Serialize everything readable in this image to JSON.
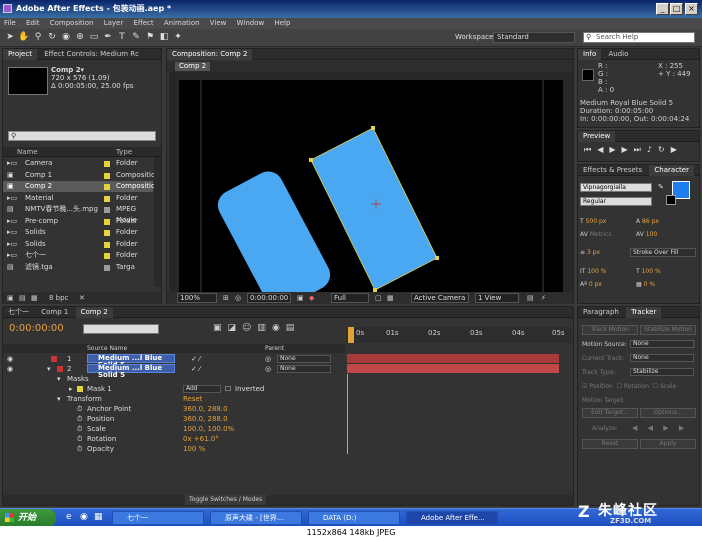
{
  "window": {
    "title": "Adobe After Effects - 包装动画.aep *"
  },
  "menu": [
    "File",
    "Edit",
    "Composition",
    "Layer",
    "Effect",
    "Animation",
    "View",
    "Window",
    "Help"
  ],
  "toolbar": {
    "workspace_label": "Workspace:",
    "workspace_value": "Standard",
    "search_placeholder": "Search Help"
  },
  "project": {
    "tabs": [
      "Project",
      "Effect Controls: Medium Rc"
    ],
    "comp_name": "Comp 2▾",
    "comp_size": "720 x 576 (1.09)",
    "comp_duration": "Δ 0:00:05:00, 25.00 fps",
    "col_name": "Name",
    "col_type": "Type",
    "items": [
      {
        "name": "Camera",
        "type": "Folder",
        "color": "#e6d23a",
        "icon": "folder-icon"
      },
      {
        "name": "Comp 1",
        "type": "Composition",
        "color": "#e6d23a",
        "icon": "composition-icon"
      },
      {
        "name": "Comp 2",
        "type": "Composition",
        "color": "#e6d23a",
        "icon": "composition-icon"
      },
      {
        "name": "Material",
        "type": "Folder",
        "color": "#e6d23a",
        "icon": "folder-icon"
      },
      {
        "name": "NMTV春节晚...头.mpg",
        "type": "MPEG Movie",
        "color": "#9a9a9a",
        "icon": "footage-icon"
      },
      {
        "name": "Pre-comp",
        "type": "Folder",
        "color": "#e6d23a",
        "icon": "folder-icon"
      },
      {
        "name": "Solids",
        "type": "Folder",
        "color": "#e6d23a",
        "icon": "folder-icon"
      },
      {
        "name": "Solids",
        "type": "Folder",
        "color": "#e6d23a",
        "icon": "folder-icon"
      },
      {
        "name": "七个一",
        "type": "Folder",
        "color": "#e6d23a",
        "icon": "folder-icon"
      },
      {
        "name": "滤镜.tga",
        "type": "Targa",
        "color": "#9a9a9a",
        "icon": "footage-icon"
      }
    ],
    "bpc": "8 bpc"
  },
  "composition": {
    "tab": "Composition: Comp 2",
    "sub_tab": "Comp 2",
    "zoom": "100%",
    "timecode": "0:00:00:00",
    "resolution": "Full",
    "camera": "Active Camera",
    "views": "1 View",
    "shape_color": "#4aa8f2"
  },
  "info": {
    "tabs": [
      "Info",
      "Audio"
    ],
    "r": "R :",
    "g": "G :",
    "b": "B :",
    "a": "A : 0",
    "x": "X : 255",
    "y": "+ Y : 449",
    "layer": "Medium Royal Blue Solid 5",
    "duration": "Duration: 0:00:05:00",
    "inout": "In: 0:00:00:00, Out: 0:00:04:24"
  },
  "preview": {
    "tab": "Preview"
  },
  "character": {
    "tabs": [
      "Effects & Presets",
      "Character"
    ],
    "font": "Vipnagorgialla",
    "style": "Regular",
    "size": "500 px",
    "leading": "86 px",
    "kerning": "Metrics",
    "tracking": "100",
    "stroke_width": "3 px",
    "stroke_type": "Stroke Over Fill",
    "vscale": "100 %",
    "hscale": "100 %",
    "baseline": "0 px",
    "tsume": "0 %",
    "fill_color": "#1e7ef0"
  },
  "tracker": {
    "tabs": [
      "Paragraph",
      "Tracker"
    ],
    "track_motion": "Track Motion",
    "stabilize": "Stabilize Motion",
    "motion_source_label": "Motion Source:",
    "motion_source": "None",
    "current_track_label": "Current Track:",
    "current_track": "None",
    "track_type_label": "Track Type:",
    "track_type": "Stabilize",
    "position": "Position",
    "rotation": "Rotation",
    "scale": "Scale",
    "motion_target": "Motion Target:",
    "edit_target": "Edit Target...",
    "options": "Options...",
    "analyze": "Analyze:",
    "reset": "Reset",
    "apply": "Apply"
  },
  "timeline": {
    "tabs": [
      "七个一",
      "Comp 1",
      "Comp 2"
    ],
    "timecode": "0:00:00:00",
    "col_source": "Source Name",
    "col_parent": "Parent",
    "ruler": [
      "0s",
      "01s",
      "02s",
      "03s",
      "04s",
      "05s"
    ],
    "layers": [
      {
        "num": "1",
        "name": "Medium ...l Blue Solid 5",
        "parent": "None"
      },
      {
        "num": "2",
        "name": "Medium ...l Blue Solid 5",
        "parent": "None"
      }
    ],
    "masks": "Masks",
    "mask1": "Mask 1",
    "mask_mode": "Add",
    "inverted": "Inverted",
    "transform": "Transform",
    "reset": "Reset",
    "props": [
      {
        "name": "Anchor Point",
        "value": "360.0, 288.0"
      },
      {
        "name": "Position",
        "value": "360.0, 288.0"
      },
      {
        "name": "Scale",
        "value": "100.0, 100.0%"
      },
      {
        "name": "Rotation",
        "value": "0x +61.0°"
      },
      {
        "name": "Opacity",
        "value": "100 %"
      }
    ],
    "toggle": "Toggle Switches / Modes"
  },
  "taskbar": {
    "start": "开始",
    "items": [
      "七个一",
      "原声大碟 - [世界...",
      "DATA (D:)",
      "Adobe After Effe..."
    ]
  },
  "status": {
    "text": "1152x864  148kb  JPEG"
  },
  "watermark": {
    "text": "朱峰社区",
    "sub": "ZF3D.COM"
  }
}
